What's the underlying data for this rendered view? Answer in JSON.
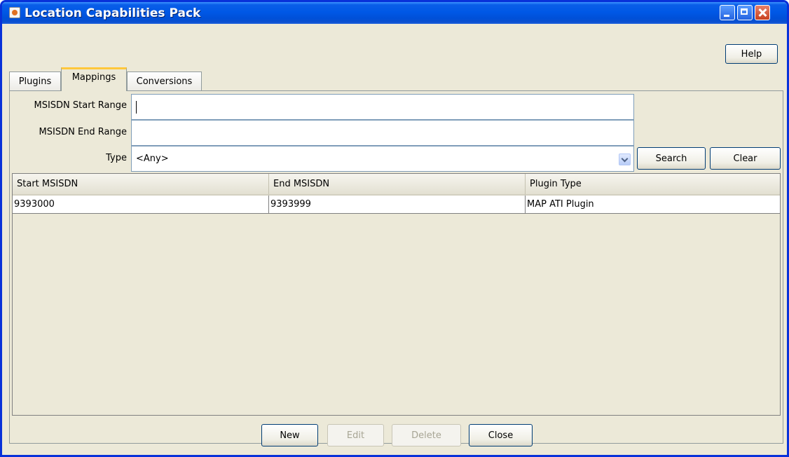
{
  "window": {
    "title": "Location Capabilities Pack"
  },
  "toolbar": {
    "help_label": "Help"
  },
  "tabs": [
    {
      "label": "Plugins",
      "active": false
    },
    {
      "label": "Mappings",
      "active": true
    },
    {
      "label": "Conversions",
      "active": false
    }
  ],
  "form": {
    "start_label": "MSISDN Start Range",
    "start_value": "",
    "end_label": "MSISDN End Range",
    "end_value": "",
    "type_label": "Type",
    "type_selected": "<Any>",
    "search_label": "Search",
    "clear_label": "Clear"
  },
  "table": {
    "columns": [
      "Start MSISDN",
      "End MSISDN",
      "Plugin Type"
    ],
    "rows": [
      [
        "9393000",
        "9393999",
        "MAP ATI Plugin"
      ]
    ]
  },
  "footer": {
    "new_label": "New",
    "edit_label": "Edit",
    "delete_label": "Delete",
    "close_label": "Close"
  },
  "colors": {
    "titlebar": "#0058e6",
    "window_bg": "#ece9d8",
    "active_tab_accent": "#ffc83c"
  }
}
